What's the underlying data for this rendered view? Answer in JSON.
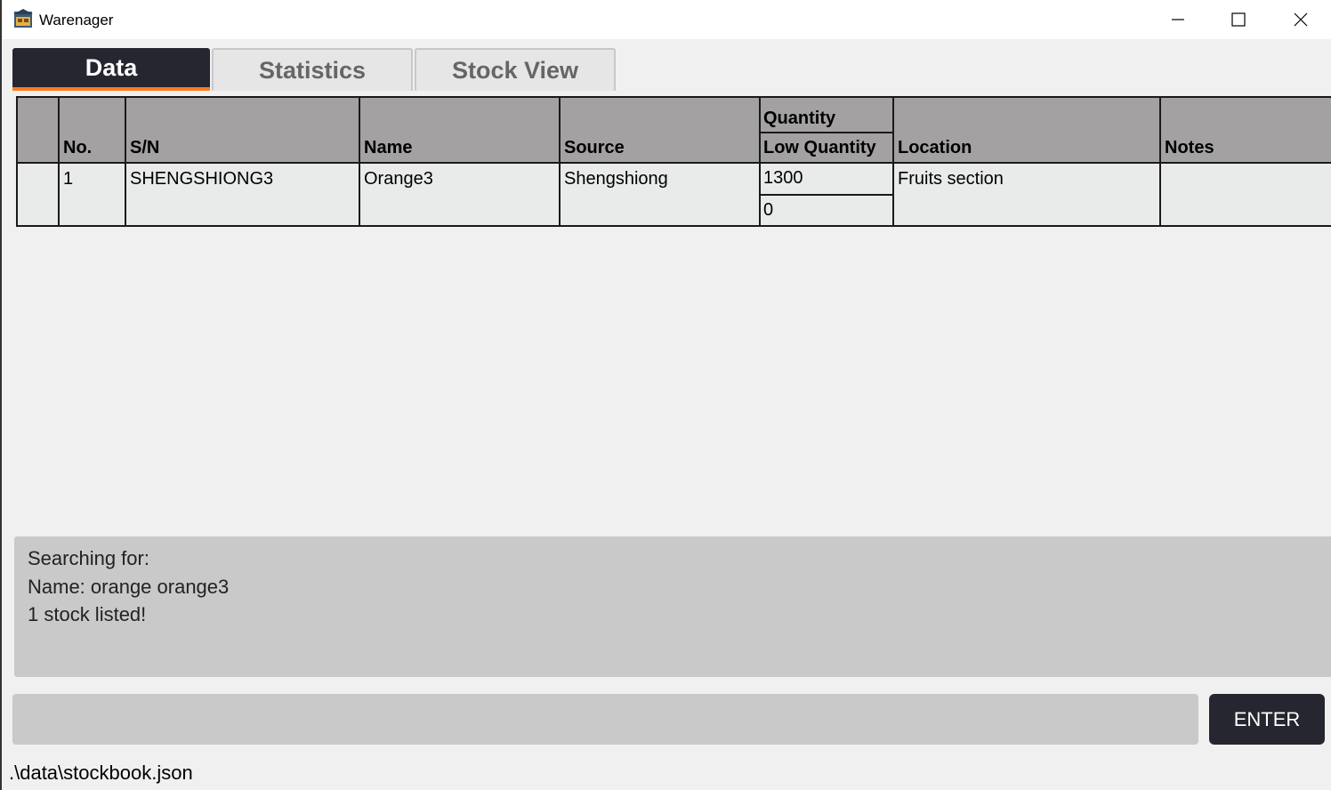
{
  "window": {
    "title": "Warenager"
  },
  "tabs": [
    {
      "label": "Data",
      "active": true
    },
    {
      "label": "Statistics",
      "active": false
    },
    {
      "label": "Stock View",
      "active": false
    }
  ],
  "table": {
    "headers": {
      "no": "No.",
      "sn": "S/N",
      "name": "Name",
      "source": "Source",
      "quantity": "Quantity",
      "low_quantity": "Low Quantity",
      "location": "Location",
      "notes": "Notes"
    },
    "rows": [
      {
        "no": "1",
        "sn": "SHENGSHIONG3",
        "name": "Orange3",
        "source": "Shengshiong",
        "quantity": "1300",
        "low_quantity": "0",
        "location": "Fruits section",
        "notes": ""
      }
    ]
  },
  "result": {
    "lines": [
      "Searching for:",
      "Name: orange orange3",
      "1 stock listed!"
    ]
  },
  "command": {
    "value": "",
    "placeholder": "",
    "enter_label": "ENTER"
  },
  "status": {
    "path": ".\\data\\stockbook.json"
  },
  "colors": {
    "tab_active_bg": "#262630",
    "tab_active_accent": "#ff7a1a",
    "header_bg": "#a3a1a2",
    "row_bg": "#e9ebeb",
    "panel_bg": "#c9c9c9"
  },
  "icons": {
    "app": "warehouse-icon",
    "minimize": "minimize-icon",
    "maximize": "maximize-icon",
    "close": "close-icon"
  }
}
